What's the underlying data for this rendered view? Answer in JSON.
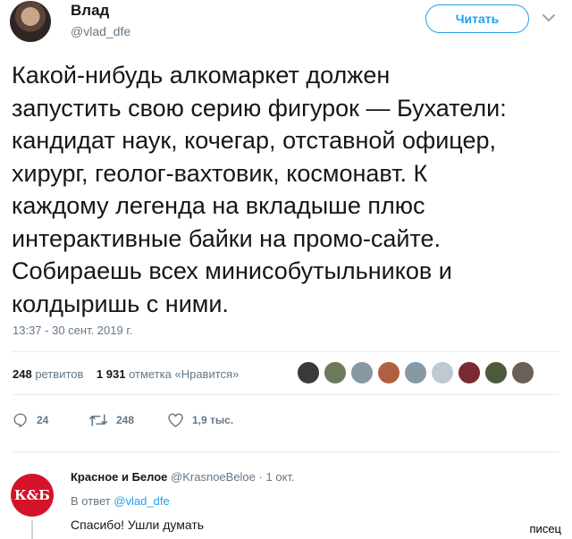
{
  "tweet": {
    "author_name": "Влад",
    "author_handle": "@vlad_dfe",
    "follow_label": "Читать",
    "text": "Какой-нибудь алкомаркет должен\nзапустить свою серию фигурок — Бухатели:\nкандидат наук, кочегар, отставной офицер,\nхирург, геолог-вахтовик, космонавт. К\nкаждому легенда на вкладыше плюс\nинтерактивные байки на промо-сайте.\nСобираешь всех минисобутыльников и\nколдыришь с ними.",
    "timestamp": "13:37 - 30 сент. 2019 г.",
    "retweet_count": "248",
    "retweet_label": "ретвитов",
    "like_count": "1 931",
    "like_label": "отметка «Нравится»",
    "liker_avatar_colors": [
      "#3a3a3a",
      "#6b7a5a",
      "#8899a6",
      "#b06040",
      "#8899a6",
      "#c0c8d0",
      "#7a2a30",
      "#4a5a3a",
      "#6a6058"
    ]
  },
  "actions": {
    "reply_count": "24",
    "retweet_count": "248",
    "like_count": "1,9 тыс."
  },
  "reply": {
    "avatar_text": "К&Б",
    "author_name": "Красное и Белое",
    "author_handle": "@KrasnoeBeloe",
    "separator": "·",
    "date": "1 окт.",
    "reply_prefix": "В ответ",
    "reply_mention": "@vlad_dfe",
    "text": "Спасибо! Ушли думать"
  },
  "watermark": "писец",
  "colors": {
    "accent": "#1da1f2",
    "muted": "#657786",
    "text": "#14171a",
    "divider": "#e6ecf0",
    "brand_red": "#d4132a"
  }
}
